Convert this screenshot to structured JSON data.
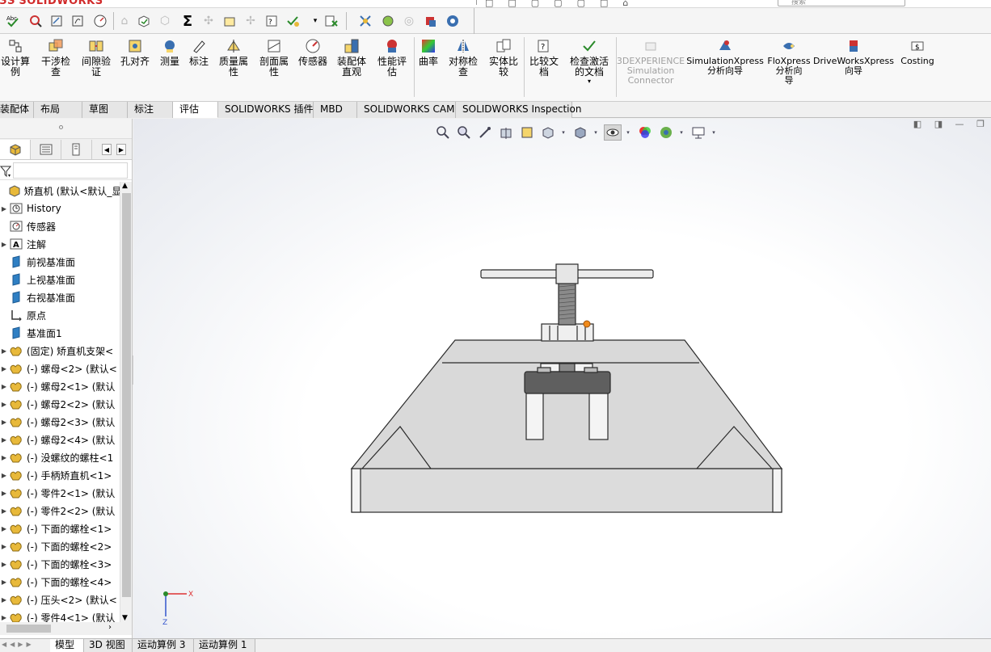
{
  "app": {
    "logo_ds": "3S",
    "logo_text": "SOLIDWORKS",
    "search_placeholder": "搜索"
  },
  "command_manager": [
    {
      "id": "design-study",
      "label": "设计算\n例",
      "icon": "design-study-icon"
    },
    {
      "id": "interference-check",
      "label": "干涉检\n查",
      "icon": "interference-icon"
    },
    {
      "id": "clearance-verification",
      "label": "间隙验\n证",
      "icon": "clearance-icon"
    },
    {
      "id": "hole-alignment",
      "label": "孔对齐",
      "icon": "hole-alignment-icon"
    },
    {
      "id": "measure",
      "label": "测量",
      "icon": "measure-icon"
    },
    {
      "id": "markup",
      "label": "标注",
      "icon": "markup-icon"
    },
    {
      "id": "mass-properties",
      "label": "质量属\n性",
      "icon": "mass-properties-icon"
    },
    {
      "id": "section-properties",
      "label": "剖面属\n性",
      "icon": "section-properties-icon"
    },
    {
      "id": "sensor",
      "label": "传感器",
      "icon": "sensor-icon"
    },
    {
      "id": "assembly-visualization",
      "label": "装配体\n直观",
      "icon": "assembly-visualization-icon"
    },
    {
      "id": "performance-evaluation",
      "label": "性能评\n估",
      "icon": "performance-icon"
    },
    {
      "id": "curvature",
      "label": "曲率",
      "icon": "curvature-icon"
    },
    {
      "id": "symmetry-check",
      "label": "对称检\n查",
      "icon": "symmetry-icon"
    },
    {
      "id": "compare-geometry",
      "label": "实体比\n较",
      "icon": "compare-geometry-icon"
    },
    {
      "id": "compare-documents",
      "label": "比较文\n档",
      "icon": "compare-documents-icon"
    },
    {
      "id": "check-active-document",
      "label": "检查激活\n的文档",
      "icon": "check-active-icon"
    },
    {
      "id": "3dexperience-connector",
      "label": "3DEXPERIENCE\nSimulation\nConnector",
      "icon": "3dexperience-icon",
      "disabled": true
    },
    {
      "id": "simulationxpress",
      "label": "SimulationXpress\n分析向导",
      "icon": "simulationxpress-icon"
    },
    {
      "id": "floxpress",
      "label": "FloXpress\n分析向\n导",
      "icon": "floxpress-icon"
    },
    {
      "id": "driveworksxpress",
      "label": "DriveWorksXpress\n向导",
      "icon": "driveworksxpress-icon"
    },
    {
      "id": "costing",
      "label": "Costing",
      "icon": "costing-icon"
    }
  ],
  "tabs": [
    {
      "label": "装配体"
    },
    {
      "label": "布局"
    },
    {
      "label": "草图"
    },
    {
      "label": "标注"
    },
    {
      "label": "评估",
      "active": true
    },
    {
      "label": "SOLIDWORKS 插件"
    },
    {
      "label": "MBD"
    },
    {
      "label": "SOLIDWORKS CAM"
    },
    {
      "label": "SOLIDWORKS Inspection"
    }
  ],
  "tree": {
    "root": "矫直机 (默认<默认_显示",
    "items": [
      {
        "text": "History",
        "icon": "history-icon",
        "expandable": true
      },
      {
        "text": "传感器",
        "icon": "sensor-icon",
        "expandable": false
      },
      {
        "text": "注解",
        "icon": "annotation-icon",
        "expandable": true
      },
      {
        "text": "前视基准面",
        "icon": "plane-icon",
        "expandable": false
      },
      {
        "text": "上视基准面",
        "icon": "plane-icon",
        "expandable": false
      },
      {
        "text": "右视基准面",
        "icon": "plane-icon",
        "expandable": false
      },
      {
        "text": "原点",
        "icon": "origin-icon",
        "expandable": false
      },
      {
        "text": "基准面1",
        "icon": "plane-icon",
        "expandable": false
      },
      {
        "text": "(固定) 矫直机支架<",
        "icon": "part-icon",
        "expandable": true
      },
      {
        "text": "(-) 螺母<2> (默认<",
        "icon": "part-icon",
        "expandable": true
      },
      {
        "text": "(-) 螺母2<1> (默认",
        "icon": "part-icon",
        "expandable": true
      },
      {
        "text": "(-) 螺母2<2> (默认",
        "icon": "part-icon",
        "expandable": true
      },
      {
        "text": "(-) 螺母2<3> (默认",
        "icon": "part-icon",
        "expandable": true
      },
      {
        "text": "(-) 螺母2<4> (默认",
        "icon": "part-icon",
        "expandable": true
      },
      {
        "text": "(-) 没螺纹的螺柱<1",
        "icon": "part-icon",
        "expandable": true
      },
      {
        "text": "(-) 手柄矫直机<1>",
        "icon": "part-icon",
        "expandable": true
      },
      {
        "text": "(-) 零件2<1> (默认",
        "icon": "part-icon",
        "expandable": true
      },
      {
        "text": "(-) 零件2<2> (默认",
        "icon": "part-icon",
        "expandable": true
      },
      {
        "text": "(-) 下面的螺栓<1>",
        "icon": "part-icon",
        "expandable": true
      },
      {
        "text": "(-) 下面的螺栓<2>",
        "icon": "part-icon",
        "expandable": true
      },
      {
        "text": "(-) 下面的螺栓<3>",
        "icon": "part-icon",
        "expandable": true
      },
      {
        "text": "(-) 下面的螺栓<4>",
        "icon": "part-icon",
        "expandable": true
      },
      {
        "text": "(-) 压头<2> (默认<",
        "icon": "part-icon",
        "expandable": true
      },
      {
        "text": "(-) 零件4<1> (默认",
        "icon": "part-icon",
        "expandable": true
      }
    ]
  },
  "triad": {
    "x": "X",
    "z": "Z"
  },
  "bottom_tabs": [
    {
      "label": "模型",
      "active": true
    },
    {
      "label": "3D 视图"
    },
    {
      "label": "运动算例 3"
    },
    {
      "label": "运动算例 1"
    }
  ],
  "colors": {
    "part_yellow": "#e8b93a",
    "plane_blue": "#2f7fc3",
    "model_fill": "#d8d8d8",
    "model_edge": "#2a2a2a"
  }
}
